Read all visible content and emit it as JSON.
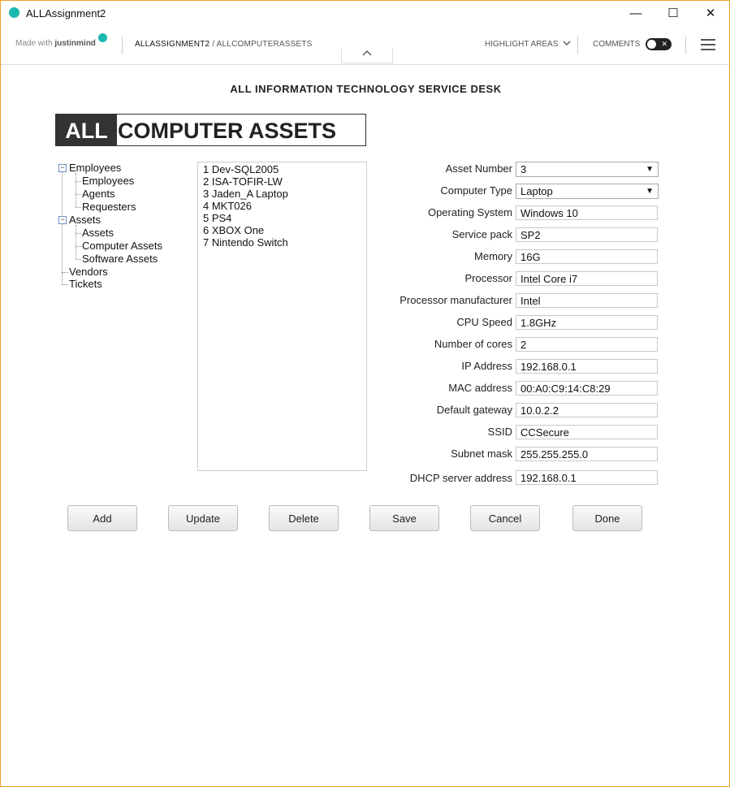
{
  "window": {
    "title": "ALLAssignment2",
    "minimize": "—",
    "maximize": "☐",
    "close": "✕"
  },
  "toolbar": {
    "made_with": "Made with",
    "brand": "justinmind",
    "breadcrumb_root": "ALLASSIGNMENT2",
    "breadcrumb_sep": " / ",
    "breadcrumb_page": "ALLCOMPUTERASSETS",
    "highlight_areas": "HIGHLIGHT AREAS",
    "comments": "COMMENTS",
    "comments_enabled": false,
    "collapse_icon": "chevron-up-icon"
  },
  "page": {
    "heading": "ALL INFORMATION TECHNOLOGY SERVICE DESK",
    "banner_left": "ALL",
    "banner_right": "COMPUTER ASSETS"
  },
  "tree": {
    "employees": "Employees",
    "employees_children": [
      "Employees",
      "Agents",
      "Requesters"
    ],
    "assets": "Assets",
    "assets_children": [
      "Assets",
      "Computer Assets",
      "Software Assets"
    ],
    "vendors": "Vendors",
    "tickets": "Tickets",
    "expander": "−"
  },
  "assets_list": [
    "1 Dev-SQL2005",
    "2 ISA-TOFIR-LW",
    "3 Jaden_A Laptop",
    "4 MKT026",
    "5 PS4",
    "6 XBOX One",
    "7 Nintendo Switch"
  ],
  "form": {
    "asset_number": {
      "label": "Asset Number",
      "value": "3"
    },
    "computer_type": {
      "label": "Computer Type",
      "value": "Laptop"
    },
    "operating_system": {
      "label": "Operating System",
      "value": "Windows 10"
    },
    "service_pack": {
      "label": "Service pack",
      "value": "SP2"
    },
    "memory": {
      "label": "Memory",
      "value": "16G"
    },
    "processor": {
      "label": "Processor",
      "value": "Intel Core i7"
    },
    "processor_manufacturer": {
      "label": "Processor manufacturer",
      "value": "Intel"
    },
    "cpu_speed": {
      "label": "CPU Speed",
      "value": "1.8GHz"
    },
    "number_of_cores": {
      "label": "Number of cores",
      "value": "2"
    },
    "ip_address": {
      "label": "IP Address",
      "value": "192.168.0.1"
    },
    "mac_address": {
      "label": "MAC address",
      "value": "00:A0:C9:14:C8:29"
    },
    "default_gateway": {
      "label": "Default gateway",
      "value": "10.0.2.2"
    },
    "ssid": {
      "label": "SSID",
      "value": "CCSecure"
    },
    "subnet_mask": {
      "label": "Subnet mask",
      "value": "255.255.255.0"
    },
    "dhcp_server": {
      "label": "DHCP server address",
      "value": "192.168.0.1"
    }
  },
  "buttons": {
    "add": "Add",
    "update": "Update",
    "delete": "Delete",
    "save": "Save",
    "cancel": "Cancel",
    "done": "Done"
  },
  "colors": {
    "window_border": "#f0a030",
    "brand_accent": "#1bb8b0",
    "banner_dark": "#333333"
  }
}
